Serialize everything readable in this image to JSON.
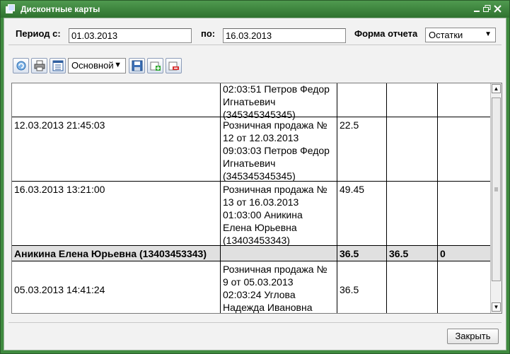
{
  "window": {
    "title": "Дисконтные карты",
    "icon": "cards-icon",
    "controls": [
      "minimize-icon",
      "maximize-icon",
      "close-icon"
    ]
  },
  "filters": {
    "period_from_label": "Период с:",
    "period_from_value": "01.03.2013",
    "period_to_label": "по:",
    "period_to_value": "16.03.2013",
    "report_form_label": "Форма отчета",
    "report_form_value": "Остатки"
  },
  "toolbar": {
    "buttons": [
      "refresh-icon",
      "print-icon",
      "columns-icon"
    ],
    "preset_value": "Основной",
    "preset_buttons": [
      "save-icon",
      "add-icon",
      "delete-icon"
    ]
  },
  "grid": {
    "rows": [
      {
        "type": "item",
        "date": "",
        "document": "02:03:51 Петров Федор\nИгнатьевич\n(345345345345)",
        "v1": "",
        "v2": "",
        "v3": ""
      },
      {
        "type": "item",
        "date": "12.03.2013 21:45:03",
        "document": "Розничная продажа №\n12 от 12.03.2013\n09:03:03 Петров Федор\nИгнатьевич\n(345345345345)",
        "v1": "22.5",
        "v2": "",
        "v3": ""
      },
      {
        "type": "item",
        "date": "16.03.2013 13:21:00",
        "document": "Розничная продажа №\n13 от 16.03.2013\n01:03:00 Аникина\nЕлена Юрьевна\n(13403453343)",
        "v1": "49.45",
        "v2": "",
        "v3": ""
      },
      {
        "type": "group",
        "date": "Аникина Елена Юрьевна (13403453343)",
        "document": "",
        "v1": "36.5",
        "v2": "36.5",
        "v3": "0"
      },
      {
        "type": "item",
        "date": "05.03.2013 14:41:24",
        "document": "Розничная продажа №\n9 от 05.03.2013\n02:03:24 Углова\nНадежда Ивановна",
        "v1": "36.5",
        "v2": "",
        "v3": ""
      }
    ]
  },
  "footer": {
    "close_label": "Закрыть"
  },
  "colors": {
    "title_bar": "#3f8a3f",
    "group_row": "#e0e0e0"
  }
}
